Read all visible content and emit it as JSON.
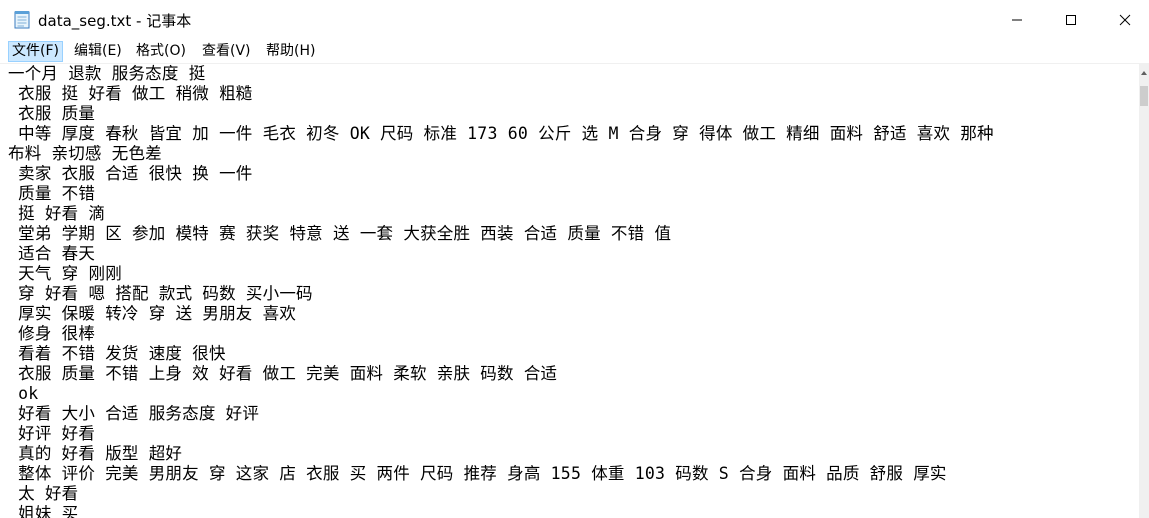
{
  "window": {
    "title": "data_seg.txt - 记事本",
    "icons": {
      "app": "notepad-icon",
      "minimize": "minimize-icon",
      "maximize": "maximize-icon",
      "close": "close-icon"
    }
  },
  "menu": {
    "items": [
      {
        "label": "文件(F)",
        "active": true
      },
      {
        "label": "编辑(E)",
        "active": false
      },
      {
        "label": "格式(O)",
        "active": false
      },
      {
        "label": "查看(V)",
        "active": false
      },
      {
        "label": "帮助(H)",
        "active": false
      }
    ]
  },
  "editor": {
    "lines": [
      "一个月 退款 服务态度 挺",
      " 衣服 挺 好看 做工 稍微 粗糙",
      " 衣服 质量",
      " 中等 厚度 春秋 皆宜 加 一件 毛衣 初冬 OK 尺码 标准 173 60 公斤 选 M 合身 穿 得体 做工 精细 面料 舒适 喜欢 那种",
      "布料 亲切感 无色差",
      " 卖家 衣服 合适 很快 换 一件",
      " 质量 不错",
      " 挺 好看 滴",
      " 堂弟 学期 区 参加 模特 赛 获奖 特意 送 一套 大获全胜 西装 合适 质量 不错 值",
      " 适合 春天",
      " 天气 穿 刚刚",
      " 穿 好看 嗯 搭配 款式 码数 买小一码",
      " 厚实 保暖 转冷 穿 送 男朋友 喜欢",
      " 修身 很棒",
      " 看着 不错 发货 速度 很快",
      " 衣服 质量 不错 上身 效 好看 做工 完美 面料 柔软 亲肤 码数 合适",
      " ok",
      " 好看 大小 合适 服务态度 好评",
      " 好评 好看",
      " 真的 好看 版型 超好",
      " 整体 评价 完美 男朋友 穿 这家 店 衣服 买 两件 尺码 推荐 身高 155 体重 103 码数 S 合身 面料 品质 舒服 厚实",
      " 太 好看",
      " 姐妹 买"
    ]
  },
  "colors": {
    "menu_active_bg": "#cce8ff",
    "menu_active_border": "#99d1ff",
    "scrollbar_track": "#f0f0f0",
    "scrollbar_thumb": "#cdcdcd"
  }
}
